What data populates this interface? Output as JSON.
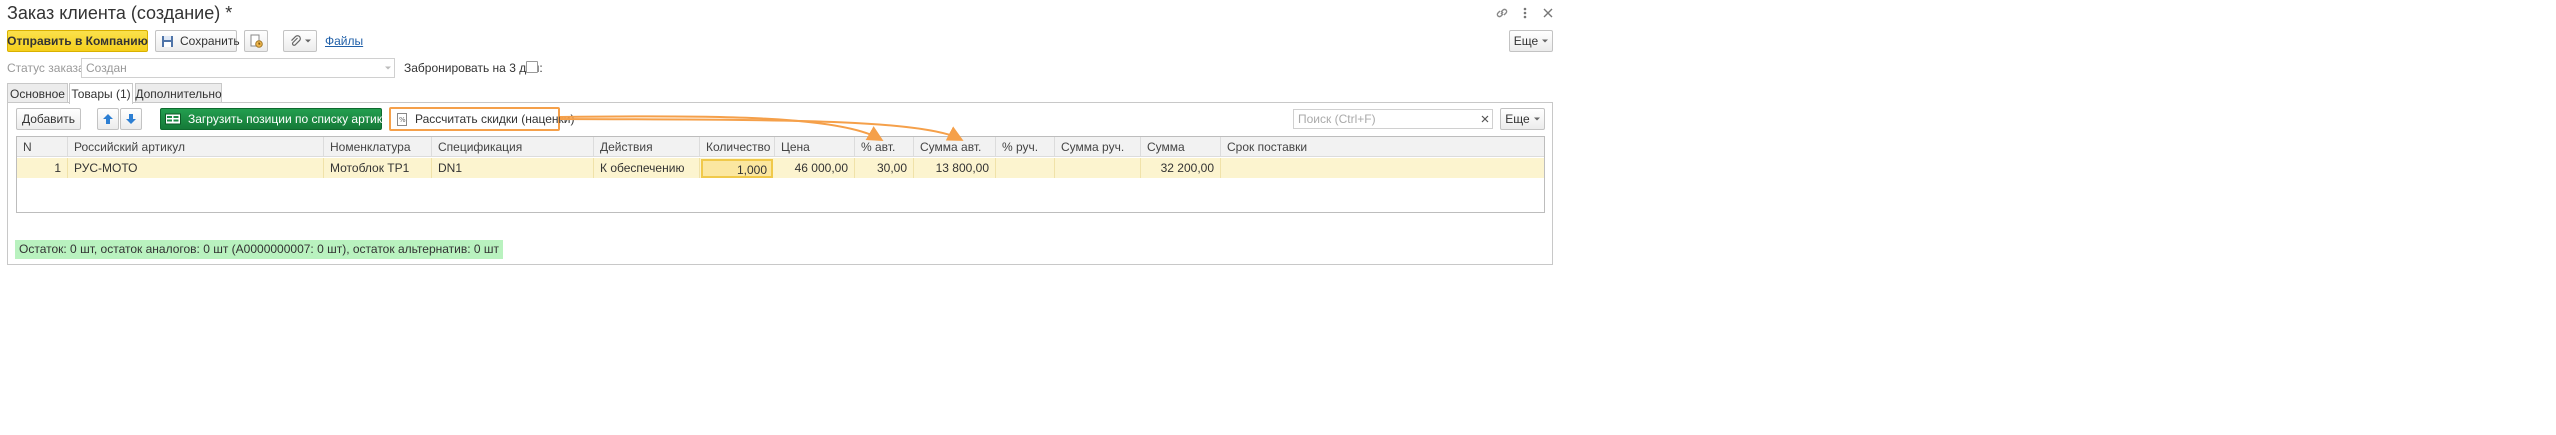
{
  "window": {
    "title": "Заказ клиента (создание) *"
  },
  "toolbar": {
    "send_label": "Отправить в Компанию",
    "save_label": "Сохранить",
    "files_label": "Файлы",
    "more_label": "Еще"
  },
  "form": {
    "status_label": "Статус заказа:",
    "status_value": "Создан",
    "reserve_label": "Забронировать на 3 дня:",
    "reserve_checked": false
  },
  "tabs": [
    {
      "label": "Основное",
      "active": false
    },
    {
      "label": "Товары (1)",
      "active": true
    },
    {
      "label": "Дополнительно",
      "active": false
    }
  ],
  "goods_toolbar": {
    "add_label": "Добавить",
    "load_label": "Загрузить позиции по списку артикулов",
    "calc_label": "Рассчитать скидки (наценки)",
    "search_placeholder": "Поиск (Ctrl+F)",
    "more_label": "Еще"
  },
  "table": {
    "columns": [
      "N",
      "Российский артикул",
      "Номенклатура",
      "Спецификация",
      "Действия",
      "Количество",
      "Цена",
      "% авт.",
      "Сумма авт.",
      "% руч.",
      "Сумма руч.",
      "Сумма",
      "Срок поставки"
    ],
    "rows": [
      {
        "n": "1",
        "article": "РУС-МОТО",
        "nomenclature": "Мотоблок TP1",
        "spec": "DN1",
        "action": "К обеспечению",
        "qty": "1,000",
        "price": "46 000,00",
        "auto_pct": "30,00",
        "auto_sum": "13 800,00",
        "manual_pct": "",
        "manual_sum": "",
        "sum": "32 200,00",
        "delivery": ""
      }
    ]
  },
  "status_bar": {
    "text": "Остаток: 0 шт, остаток аналогов: 0 шт (А0000000007: 0 шт), остаток альтернатив: 0 шт"
  },
  "colors": {
    "accent_yellow": "#f5cf1c",
    "green_button": "#1a8a43",
    "row_highlight": "#fcf4cf",
    "annotation_orange": "#f5a04a",
    "status_green": "#b9f2bf"
  }
}
